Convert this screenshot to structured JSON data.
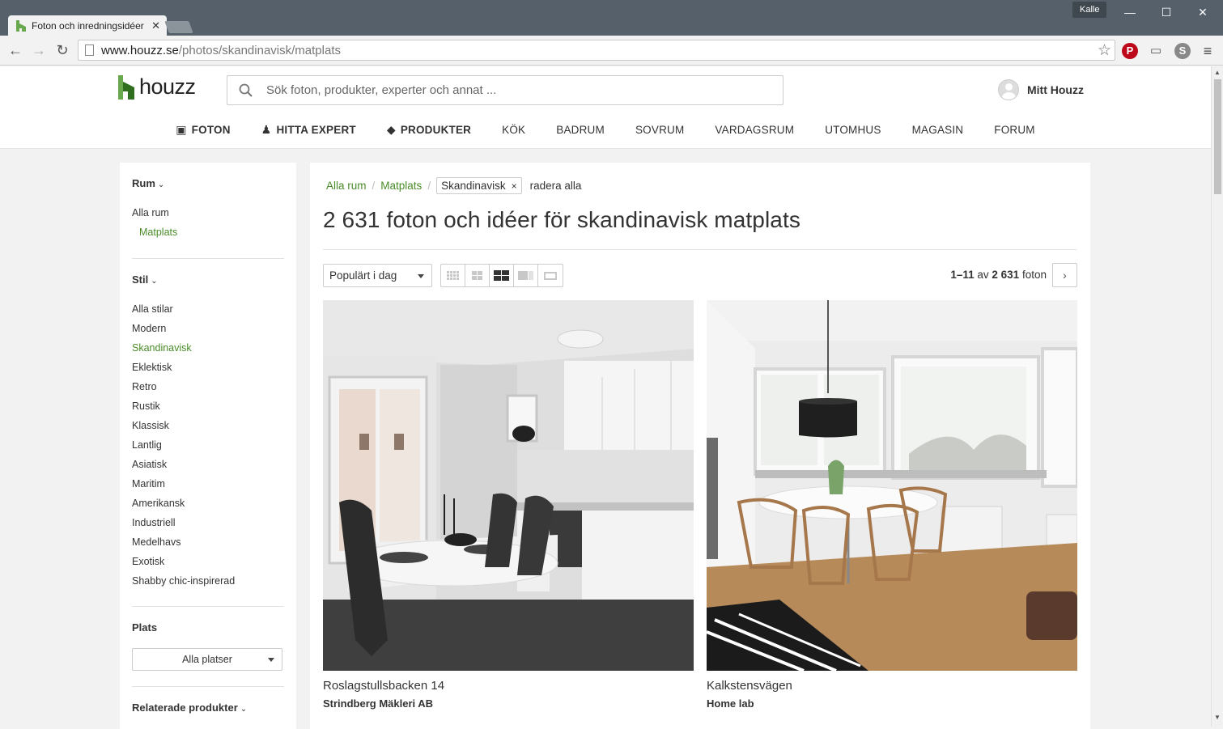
{
  "browser": {
    "tab_title": "Foton och inredningsidéer",
    "user_badge": "Kalle",
    "window_controls": {
      "minimize": "—",
      "maximize": "☐",
      "close": "✕"
    },
    "nav_back": "←",
    "nav_forward": "→",
    "nav_reload": "↻",
    "url_host": "www.houzz.se",
    "url_path": "/photos/skandinavisk/matplats",
    "bookmark_star": "☆",
    "menu_icon": "≡"
  },
  "header": {
    "logo_text": "houzz",
    "search_placeholder": "Sök foton, produkter, experter och annat ...",
    "my_houzz": "Mitt Houzz",
    "nav": [
      {
        "label": "FOTON",
        "icon": "photo-icon"
      },
      {
        "label": "HITTA EXPERT",
        "icon": "expert-icon"
      },
      {
        "label": "PRODUKTER",
        "icon": "tag-icon"
      },
      {
        "label": "KÖK"
      },
      {
        "label": "BADRUM"
      },
      {
        "label": "SOVRUM"
      },
      {
        "label": "VARDAGSRUM"
      },
      {
        "label": "UTOMHUS"
      },
      {
        "label": "MAGASIN"
      },
      {
        "label": "FORUM"
      }
    ]
  },
  "sidebar": {
    "rum_heading": "Rum",
    "rum_items": [
      "Alla rum",
      "Matplats"
    ],
    "stil_heading": "Stil",
    "stil_items": [
      "Alla stilar",
      "Modern",
      "Skandinavisk",
      "Eklektisk",
      "Retro",
      "Rustik",
      "Klassisk",
      "Lantlig",
      "Asiatisk",
      "Maritim",
      "Amerikansk",
      "Industriell",
      "Medelhavs",
      "Exotisk",
      "Shabby chic-inspirerad"
    ],
    "stil_active": "Skandinavisk",
    "plats_heading": "Plats",
    "plats_select": "Alla platser",
    "related_heading": "Relaterade produkter"
  },
  "content": {
    "breadcrumb": {
      "all_rooms": "Alla rum",
      "room": "Matplats",
      "style_chip": "Skandinavisk",
      "chip_remove": "×",
      "clear_all": "radera alla"
    },
    "title": "2 631 foton och idéer för skandinavisk matplats",
    "sort_value": "Populärt i dag",
    "view_modes": [
      "small-grid",
      "medium-grid",
      "large-grid",
      "single",
      "list"
    ],
    "active_view": "large-grid",
    "count": {
      "range": "1–11",
      "of": "av",
      "total": "2 631",
      "unit": "foton"
    },
    "next_label": "›",
    "photos": [
      {
        "title": "Roslagstullsbacken 14",
        "author": "Strindberg Mäkleri AB"
      },
      {
        "title": "Kalkstensvägen",
        "author": "Home lab"
      }
    ]
  },
  "colors": {
    "brand_green": "#4a8c2a",
    "chrome_dark": "#56606b",
    "pinterest": "#bd081c"
  }
}
